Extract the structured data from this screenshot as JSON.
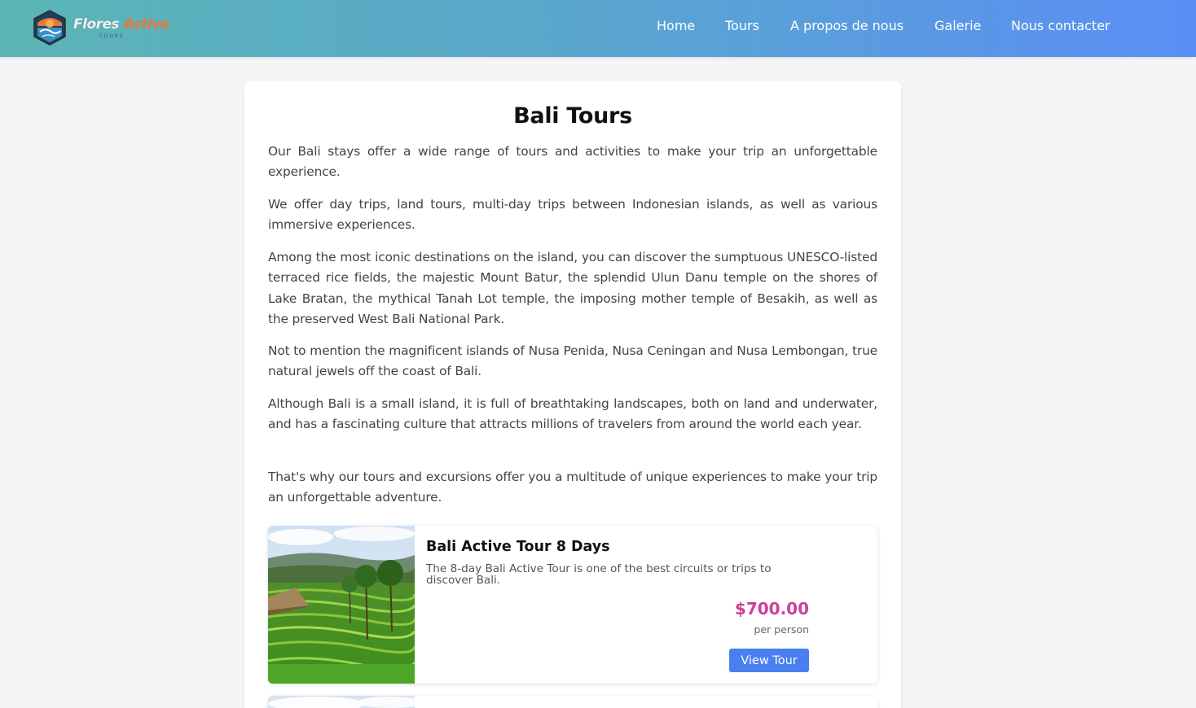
{
  "brand": {
    "name_part1": "Flores",
    "name_part2": "Active",
    "tagline": "TOURS"
  },
  "nav": {
    "items": [
      "Home",
      "Tours",
      "A propos de nous",
      "Galerie",
      "Nous contacter"
    ]
  },
  "page": {
    "title": "Bali Tours",
    "paragraphs": [
      "Our Bali stays offer a wide range of tours and activities to make your trip an unforgettable experience.",
      "We offer day trips, land tours, multi-day trips between Indonesian islands, as well as various immersive experiences.",
      "Among the most iconic destinations on the island, you can discover the sumptuous UNESCO-listed terraced rice fields, the majestic Mount Batur, the splendid Ulun Danu temple on the shores of Lake Bratan, the mythical Tanah Lot temple, the imposing mother temple of Besakih, as well as the preserved West Bali National Park.",
      "Not to mention the magnificent islands of Nusa Penida, Nusa Ceningan and Nusa Lembongan, true natural jewels off the coast of Bali.",
      "Although Bali is a small island, it is full of breathtaking landscapes, both on land and underwater, and has a fascinating culture that attracts millions of travelers from around the world each year.",
      "That's why our tours and excursions offer you a multitude of unique experiences to make your trip an unforgettable adventure."
    ]
  },
  "tours": [
    {
      "name": "Bali Active Tour 8 Days",
      "description": "The 8-day Bali Active Tour is one of the best circuits or trips to discover Bali.",
      "price": "$700.00",
      "price_unit": "per person",
      "button_label": "View Tour"
    }
  ],
  "colors": {
    "header_start": "#5bb5b5",
    "header_end": "#5a8ef5",
    "price": "#cc3f9a",
    "button": "#4a7ff0",
    "brand_accent": "#e8783a"
  }
}
